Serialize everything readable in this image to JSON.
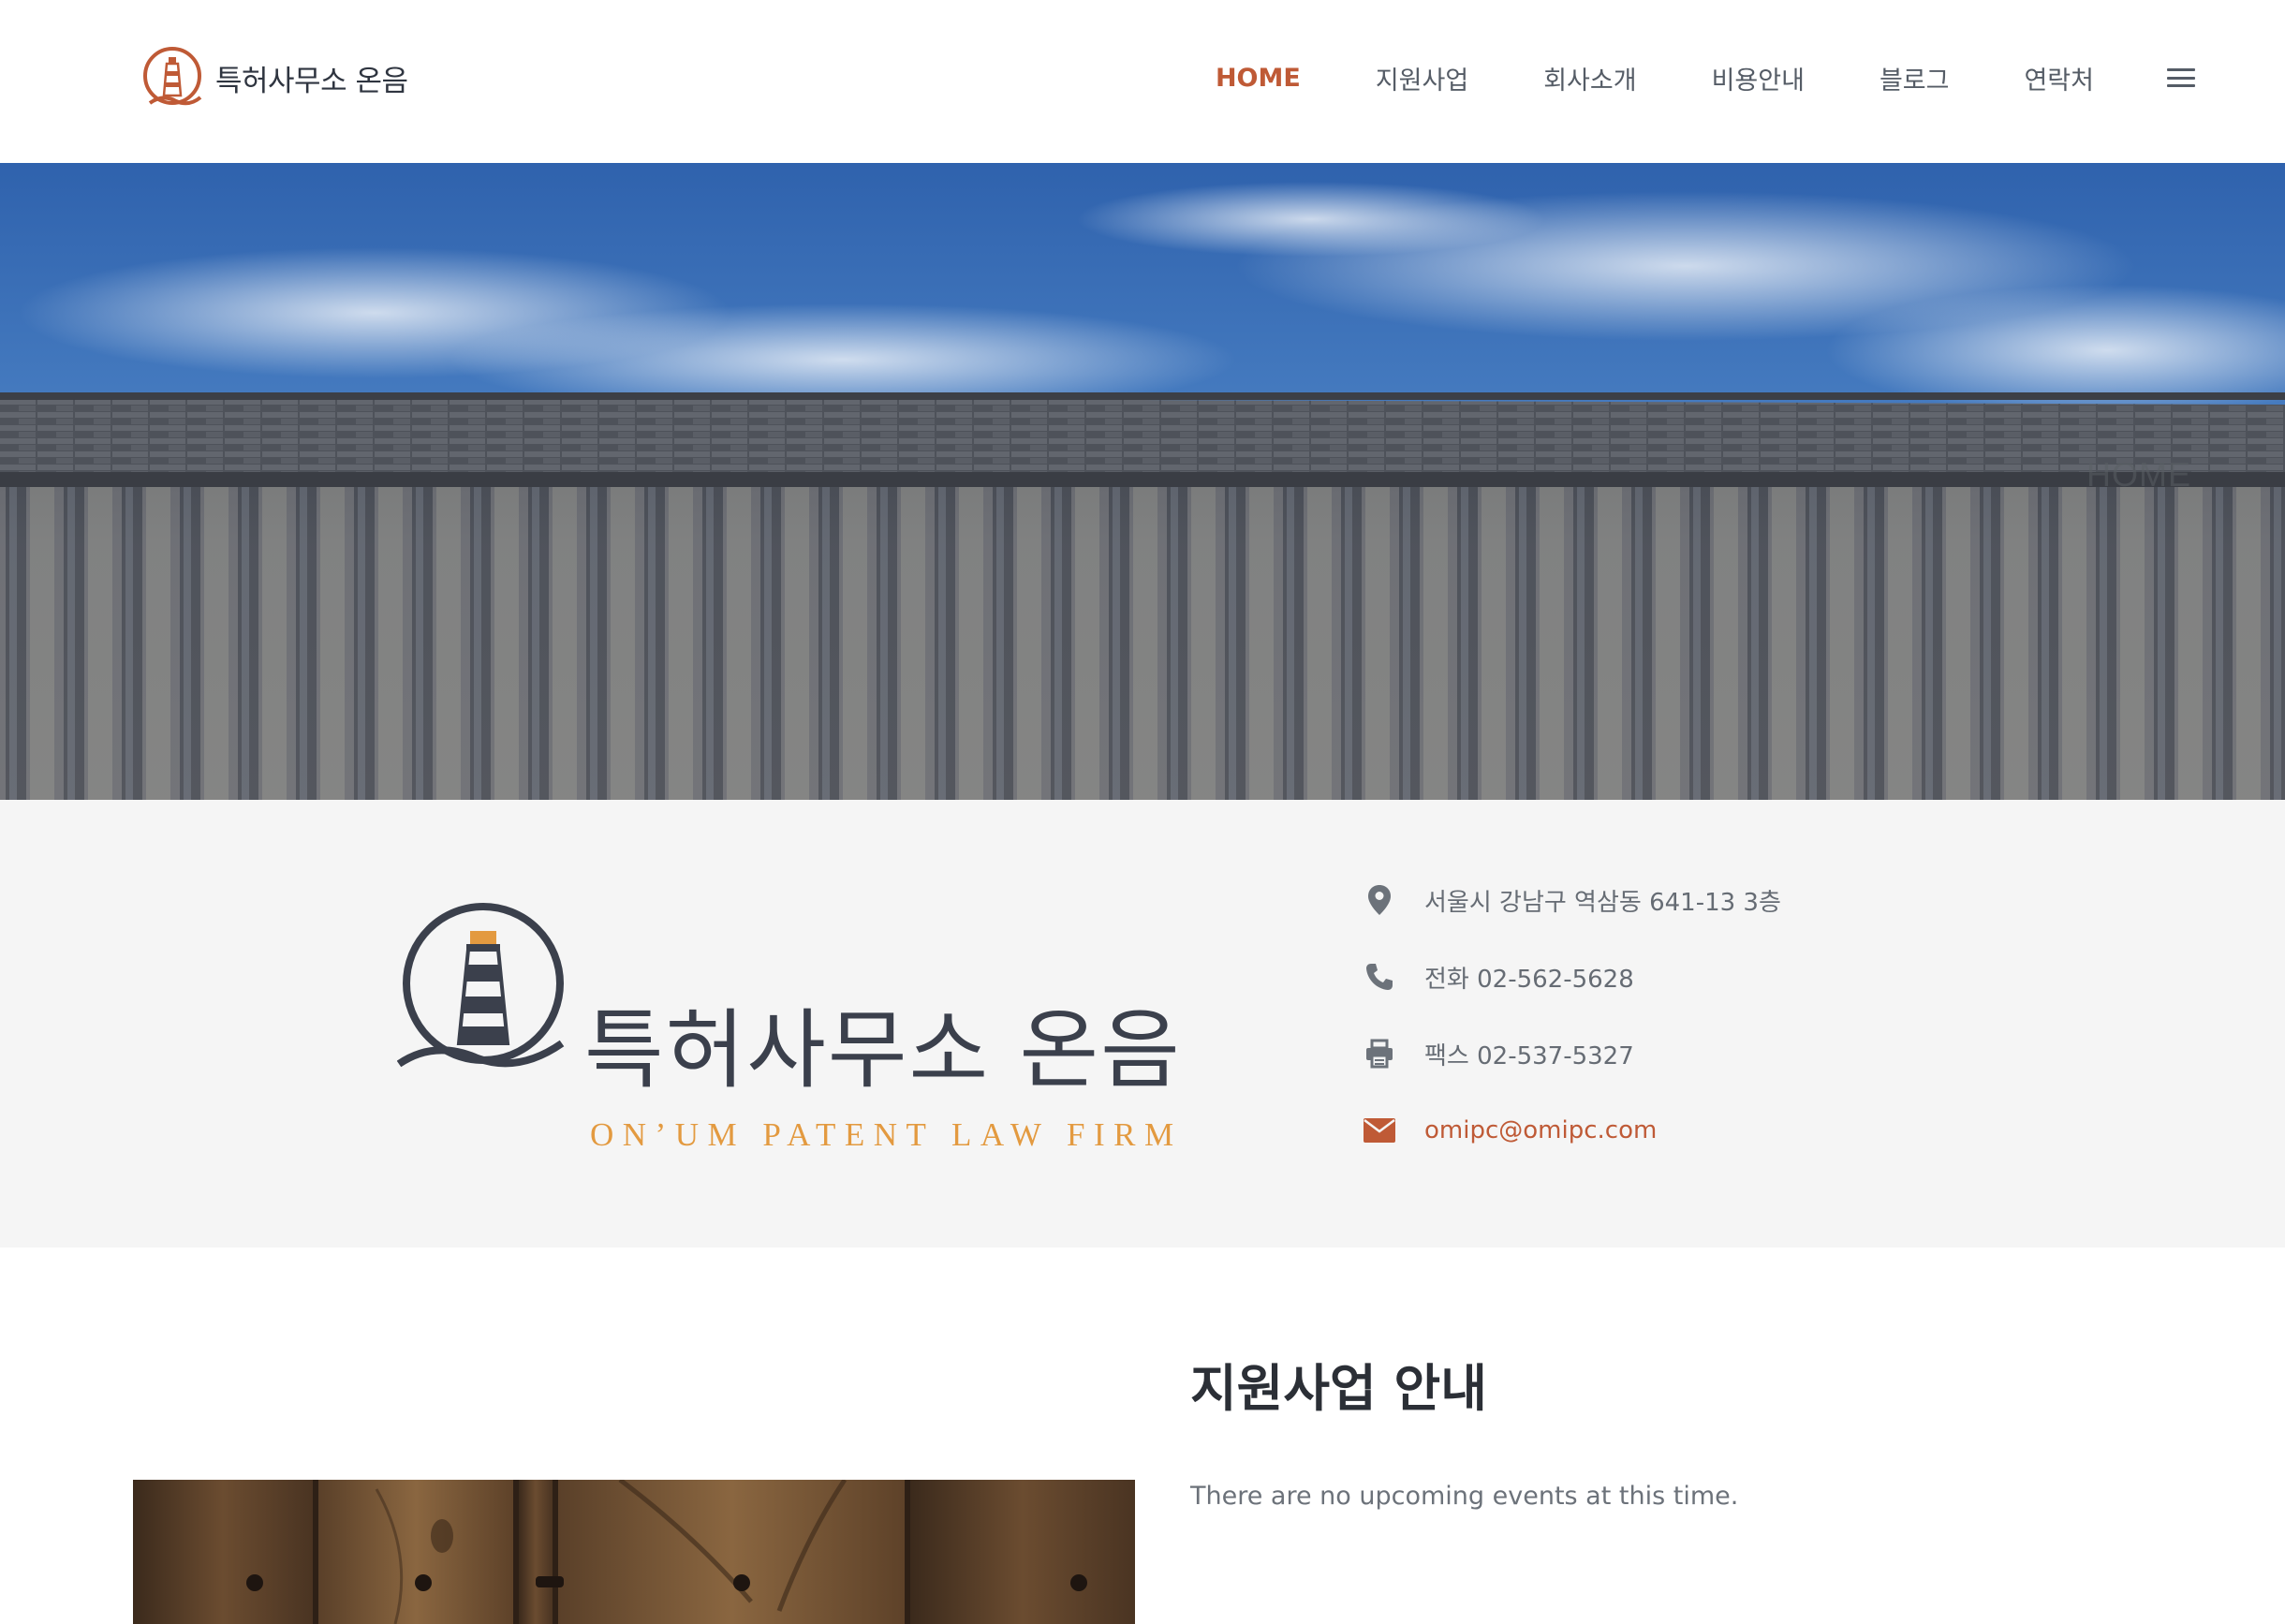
{
  "header": {
    "brand_name": "특허사무소 온음",
    "nav": [
      {
        "label": "HOME",
        "active": true
      },
      {
        "label": "지원사업",
        "active": false
      },
      {
        "label": "회사소개",
        "active": false
      },
      {
        "label": "비용안내",
        "active": false
      },
      {
        "label": "블로그",
        "active": false
      },
      {
        "label": "연락처",
        "active": false
      }
    ],
    "menu_icon": "hamburger-icon"
  },
  "hero": {
    "breadcrumb": "HOME"
  },
  "info": {
    "logo_korean": "특허사무소 온음",
    "logo_english": "ON’UM PATENT LAW FIRM",
    "contacts": {
      "address": {
        "icon": "map-pin-icon",
        "text": "서울시 강남구 역삼동 641-13 3층"
      },
      "phone": {
        "icon": "phone-icon",
        "text": "전화 02-562-5628"
      },
      "fax": {
        "icon": "fax-icon",
        "text": "팩스 02-537-5327"
      },
      "email": {
        "icon": "envelope-icon",
        "text": "omipc@omipc.com"
      }
    }
  },
  "main": {
    "title": "지원사업 안내",
    "body": "There are no upcoming events at this time."
  },
  "colors": {
    "accent": "#bf5a36",
    "logo_navy": "#3b404c",
    "logo_orange": "#e39a40",
    "band_bg": "#f5f5f5"
  }
}
